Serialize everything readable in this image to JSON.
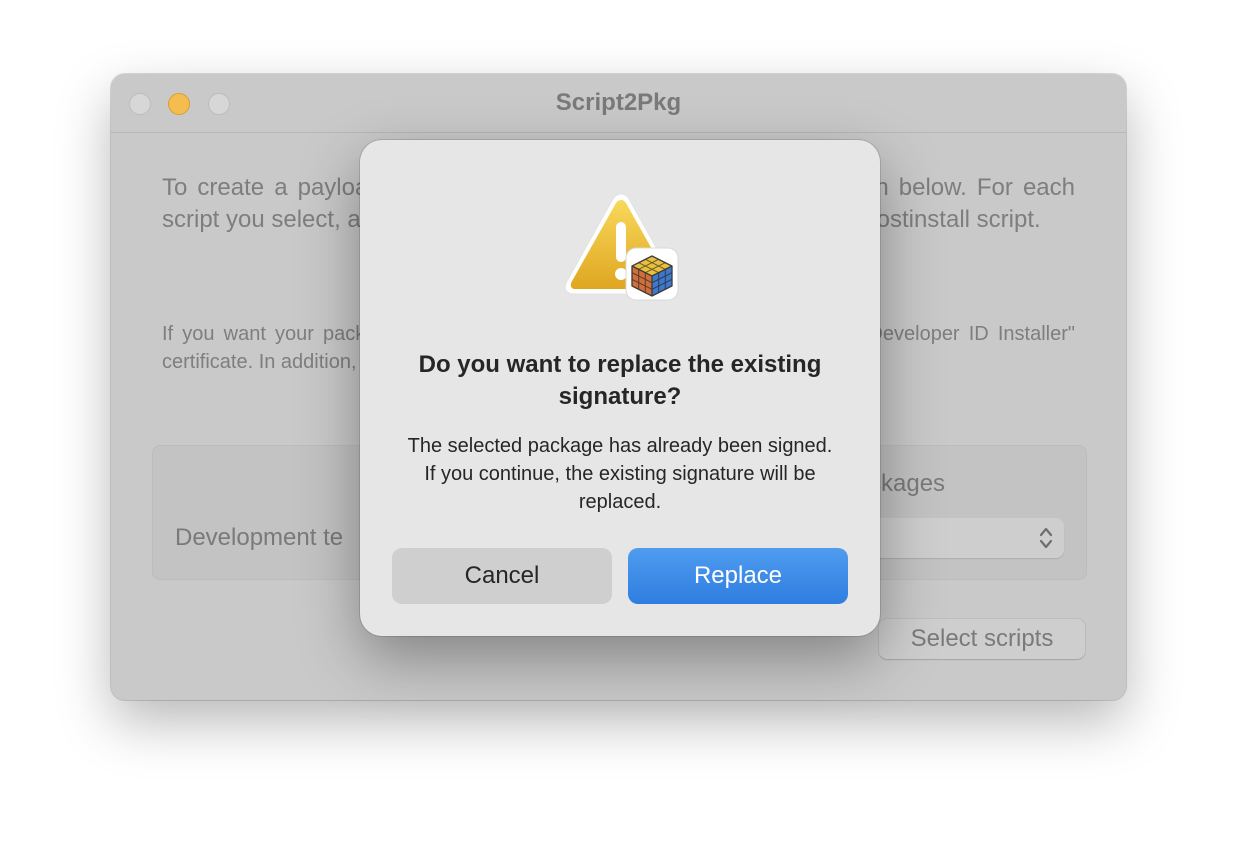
{
  "window": {
    "title": "Script2Pkg",
    "intro_text": "To create a payload-free package, click the \"Select scripts\" button below. For each script you select, a package is created. The script is added as the postinstall script.",
    "note_text": "If you want your packages signed, make sure you have at least one valid \"Developer ID Installer\" certificate. In addition, the Command Line Tools for Xcode must be installed.",
    "signing_section": {
      "dev_team_label": "Development te",
      "packages_label": "ckages"
    },
    "select_scripts_label": "Select scripts"
  },
  "dialog": {
    "icon": "warning-icon",
    "badge_icon": "package-cube-icon",
    "title": "Do you want to replace the existing signature?",
    "message": "The selected package has already been signed. If you continue, the existing signature will be replaced.",
    "cancel_label": "Cancel",
    "replace_label": "Replace"
  },
  "colors": {
    "accent": "#3b87e6",
    "warning": "#f3c33a"
  }
}
